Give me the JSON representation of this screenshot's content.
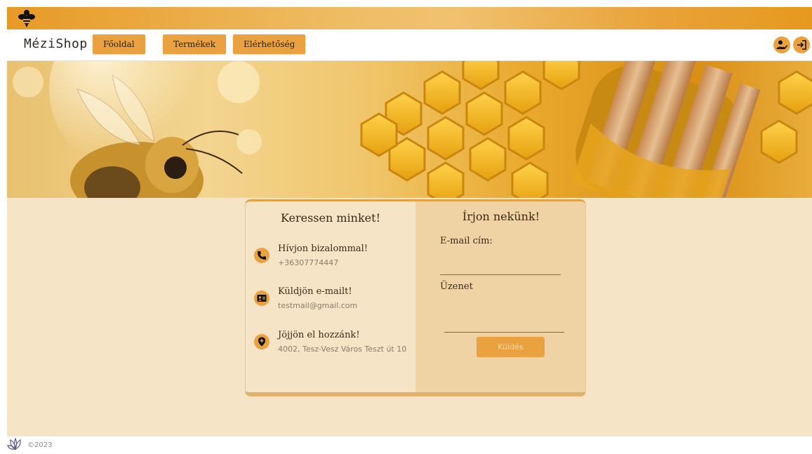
{
  "colors": {
    "accent": "#e9a23f",
    "page_bg": "#f6e4c7",
    "card_right_bg": "#efd3a4"
  },
  "header": {
    "logo_icon": "bee-icon"
  },
  "nav": {
    "brand": "MéziShop",
    "items": [
      {
        "label": "Főoldal"
      },
      {
        "label": "Termékek"
      },
      {
        "label": "Elérhetőség"
      }
    ],
    "user_icon": "user-check-icon",
    "login_icon": "login-icon"
  },
  "hero": {
    "image": "bee-and-honeycomb-banner"
  },
  "contact": {
    "title": "Keressen minket!",
    "items": [
      {
        "icon": "phone-icon",
        "heading": "Hívjon bizalommal!",
        "value": "+36307774447"
      },
      {
        "icon": "id-card-icon",
        "heading": "Küldjön e-mailt!",
        "value": "testmail@gmail.com"
      },
      {
        "icon": "map-pin-icon",
        "heading": "Jöjjön el hozzánk!",
        "value": "4002, Tesz-Vesz Város Teszt út 10"
      }
    ]
  },
  "form": {
    "title": "Írjon nekünk!",
    "email_label": "E-mail cím:",
    "email_value": "",
    "message_label": "Üzenet",
    "message_value": "",
    "submit_label": "Küldés"
  },
  "footer": {
    "logo_icon": "flower-logo-icon",
    "copyright": "©2023"
  }
}
